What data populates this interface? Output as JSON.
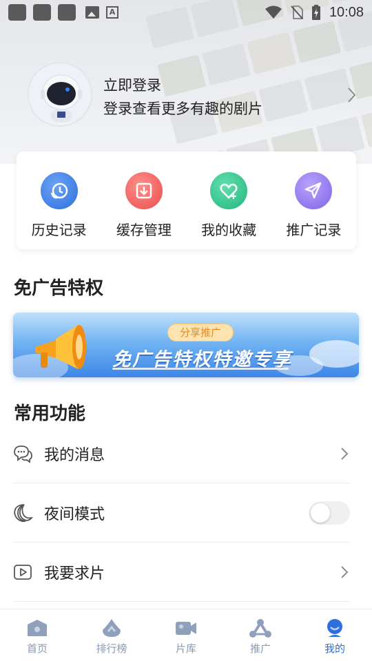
{
  "status_bar": {
    "time": "10:08"
  },
  "profile": {
    "title": "立即登录",
    "subtitle": "登录查看更多有趣的剧片"
  },
  "quick_actions": [
    {
      "label": "历史记录",
      "icon": "history-icon",
      "color": "#3b7de6"
    },
    {
      "label": "缓存管理",
      "icon": "download-icon",
      "color": "#ec5a5a"
    },
    {
      "label": "我的收藏",
      "icon": "heart-icon",
      "color": "#2fbf8b"
    },
    {
      "label": "推广记录",
      "icon": "send-icon",
      "color": "#8a6ff0"
    }
  ],
  "ad_section": {
    "title": "免广告特权",
    "banner_tag": "分享推广",
    "banner_text": "免广告特权特邀专享"
  },
  "common_section": {
    "title": "常用功能",
    "items": [
      {
        "label": "我的消息",
        "icon": "chat-bubbles-icon",
        "control": "chevron"
      },
      {
        "label": "夜间模式",
        "icon": "moon-icon",
        "control": "toggle",
        "toggle_on": false
      },
      {
        "label": "我要求片",
        "icon": "play-box-icon",
        "control": "chevron"
      }
    ]
  },
  "bottom_nav": {
    "items": [
      {
        "label": "首页",
        "icon": "home-icon",
        "active": false
      },
      {
        "label": "排行榜",
        "icon": "ranking-icon",
        "active": false
      },
      {
        "label": "片库",
        "icon": "video-camera-icon",
        "active": false
      },
      {
        "label": "推广",
        "icon": "share-network-icon",
        "active": false
      },
      {
        "label": "我的",
        "icon": "profile-icon",
        "active": true
      }
    ],
    "active_color": "#2d6fdc",
    "inactive_color": "#8a9ab5"
  }
}
